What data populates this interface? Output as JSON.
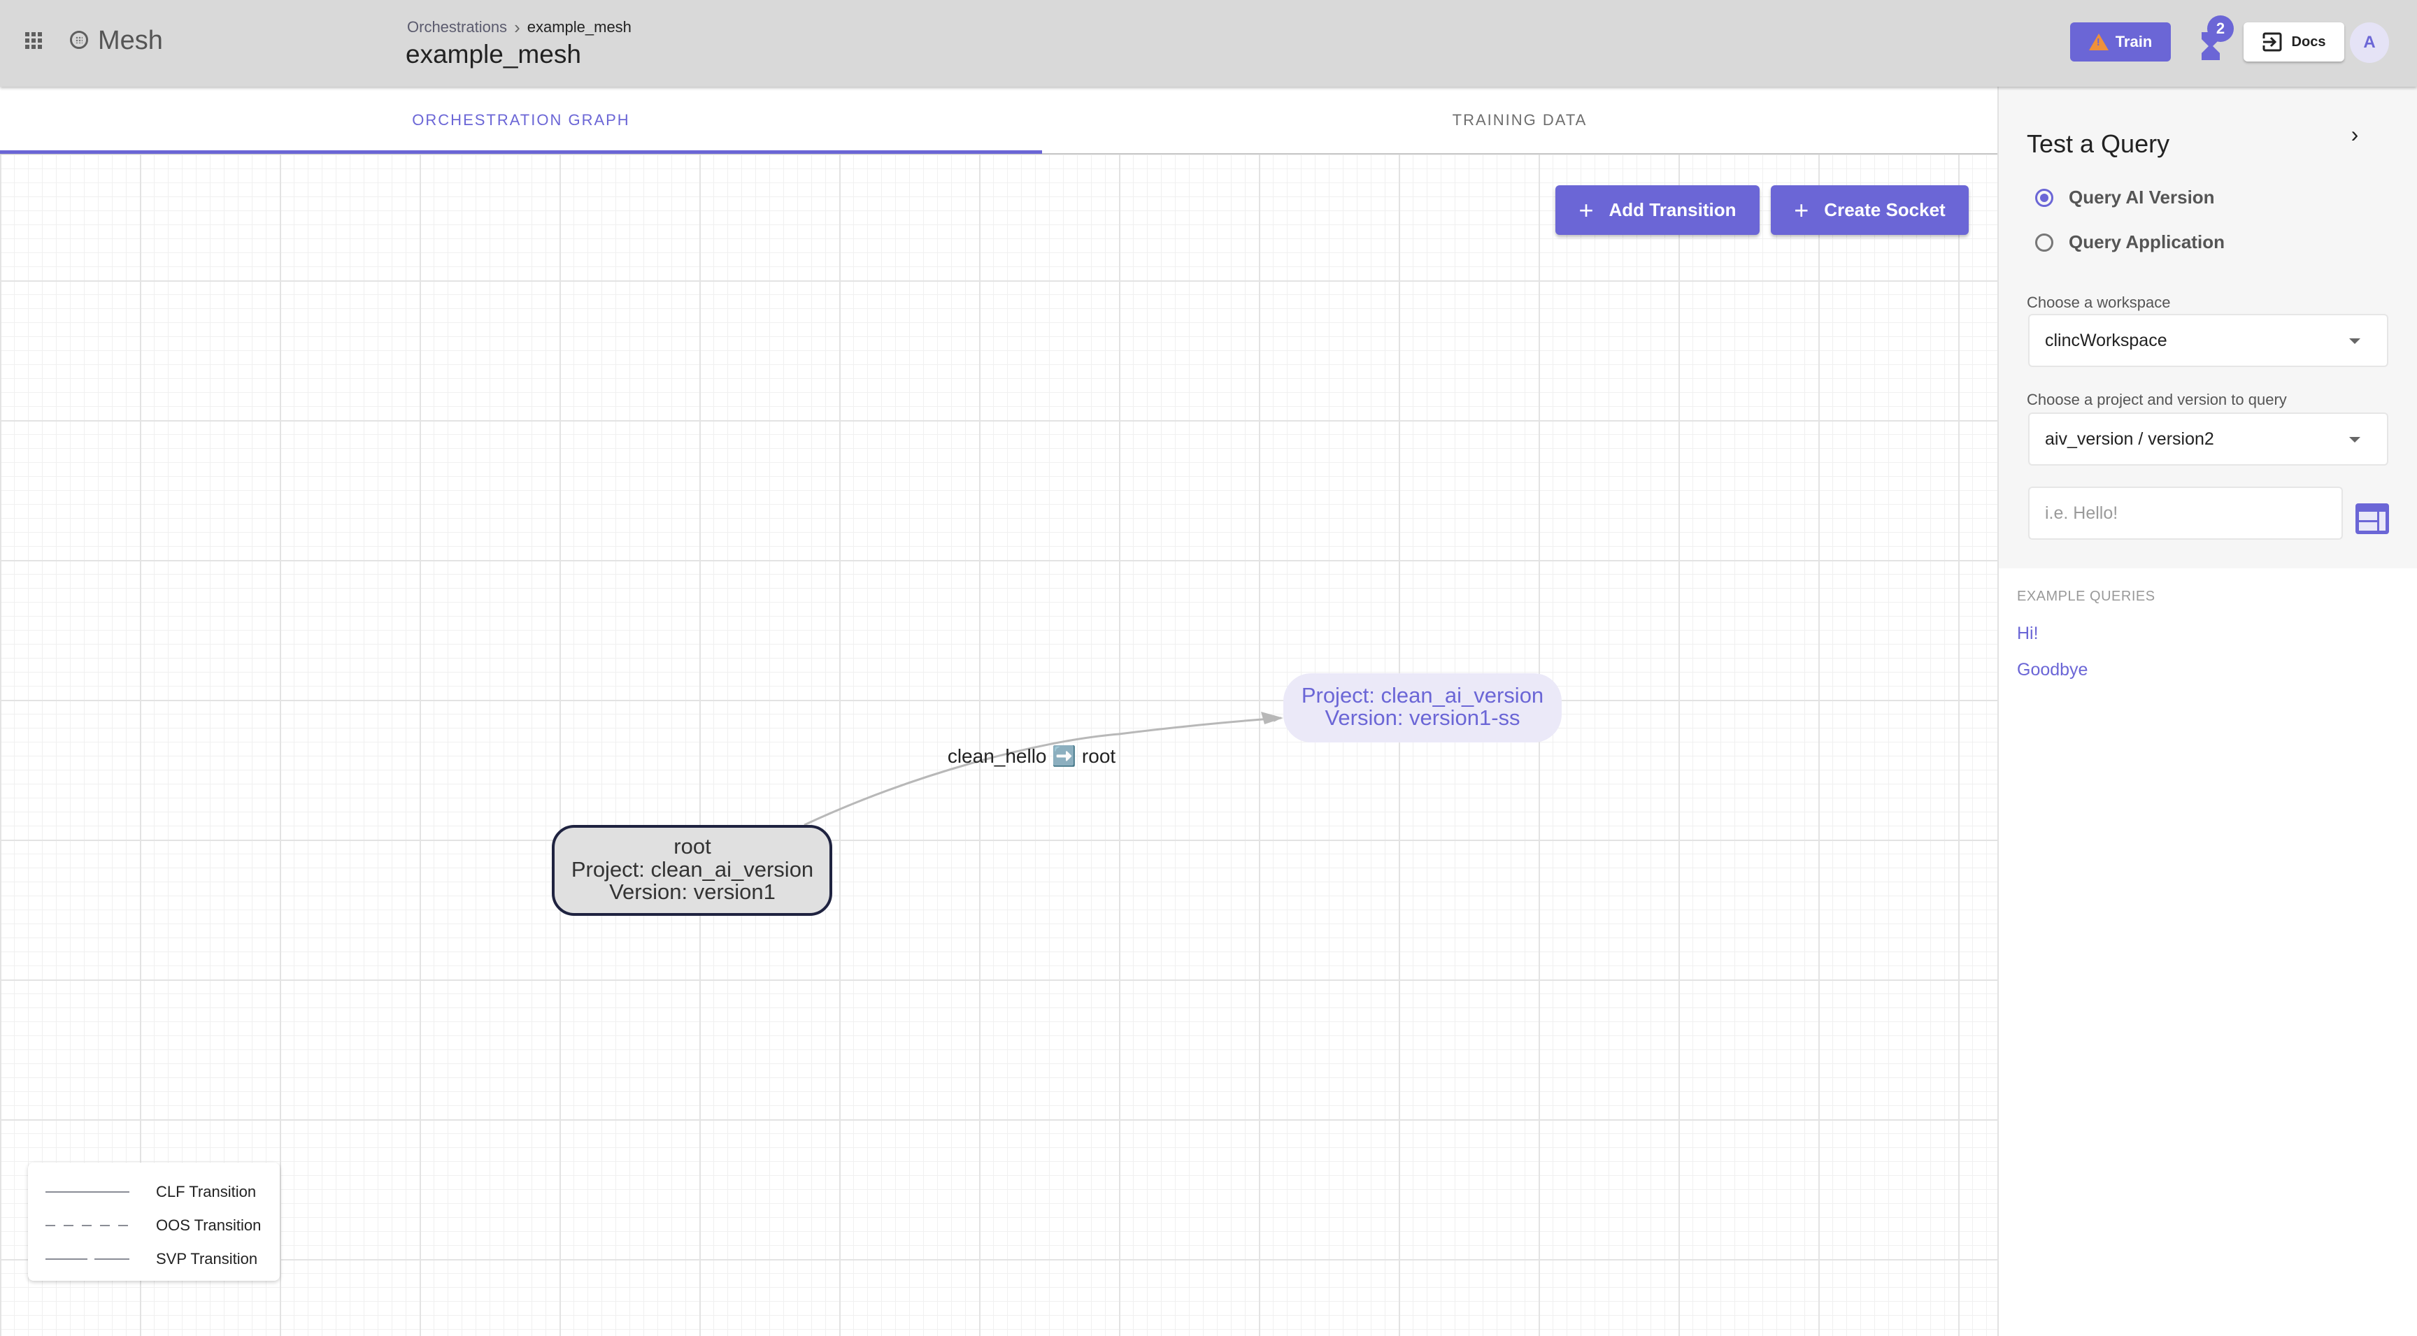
{
  "header": {
    "app_name": "Mesh",
    "breadcrumb": {
      "parent": "Orchestrations",
      "current": "example_mesh"
    },
    "page_title": "example_mesh",
    "train_label": "Train",
    "tasks_badge_count": "2",
    "docs_label": "Docs",
    "avatar_initial": "A",
    "icons": {
      "apps": "apps-grid-icon",
      "logo": "mesh-logo-icon",
      "train": "warning-icon",
      "tasks": "hourglass-icon",
      "docs": "exit-to-app-icon"
    }
  },
  "tabs": [
    {
      "label": "ORCHESTRATION GRAPH",
      "active": true
    },
    {
      "label": "TRAINING DATA",
      "active": false
    }
  ],
  "canvas": {
    "add_transition_label": "Add Transition",
    "create_socket_label": "Create Socket",
    "nodes": [
      {
        "id": "root",
        "lines": [
          "root",
          "Project: clean_ai_version",
          "Version: version1"
        ],
        "style": "root"
      },
      {
        "id": "socket",
        "lines": [
          "Project: clean_ai_version",
          "Version: version1-ss"
        ],
        "style": "socket"
      }
    ],
    "edges": [
      {
        "from": "root",
        "to": "socket",
        "label": "clean_hello ➡️ root",
        "type": "CLF"
      }
    ],
    "legend": [
      {
        "label": "CLF Transition",
        "style": "solid"
      },
      {
        "label": "OOS Transition",
        "style": "dashed"
      },
      {
        "label": "SVP Transition",
        "style": "long-dash"
      }
    ]
  },
  "query_panel": {
    "title": "Test a Query",
    "modes": [
      {
        "label": "Query AI Version",
        "checked": true
      },
      {
        "label": "Query Application",
        "checked": false
      }
    ],
    "workspace_label": "Choose a workspace",
    "workspace_value": "clincWorkspace",
    "project_label": "Choose a project and version to query",
    "project_value": "aiv_version / version2",
    "query_placeholder": "i.e. Hello!",
    "query_value": "",
    "examples_title": "EXAMPLE QUERIES",
    "examples": [
      "Hi!",
      "Goodbye"
    ]
  },
  "colors": {
    "accent": "#6b66d6",
    "warning": "#f0913a",
    "header_bg": "#d9d9d9",
    "root_node_fill": "#e0e0e0",
    "root_node_border": "#1f2340",
    "socket_node_fill": "#ebe9f8",
    "edge": "#b8b8b8"
  }
}
